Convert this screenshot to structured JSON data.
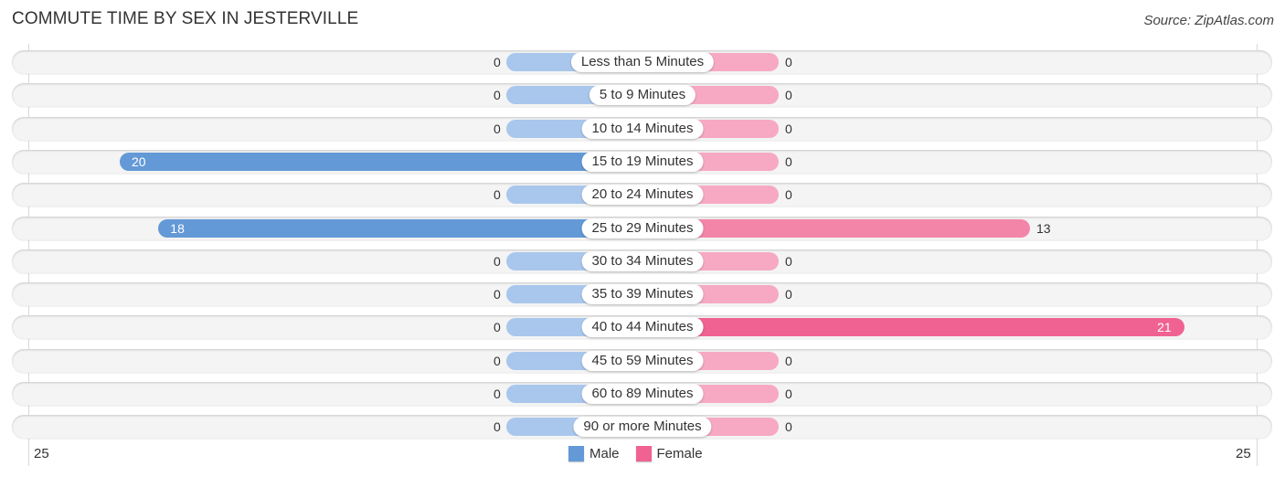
{
  "chart_data": {
    "type": "bar",
    "orientation": "horizontal-diverging",
    "title": "COMMUTE TIME BY SEX IN JESTERVILLE",
    "source": "Source: ZipAtlas.com",
    "categories": [
      "Less than 5 Minutes",
      "5 to 9 Minutes",
      "10 to 14 Minutes",
      "15 to 19 Minutes",
      "20 to 24 Minutes",
      "25 to 29 Minutes",
      "30 to 34 Minutes",
      "35 to 39 Minutes",
      "40 to 44 Minutes",
      "45 to 59 Minutes",
      "60 to 89 Minutes",
      "90 or more Minutes"
    ],
    "series": [
      {
        "name": "Male",
        "values": [
          0,
          0,
          0,
          20,
          0,
          18,
          0,
          0,
          0,
          0,
          0,
          0
        ]
      },
      {
        "name": "Female",
        "values": [
          0,
          0,
          0,
          0,
          0,
          13,
          0,
          0,
          21,
          0,
          0,
          0
        ]
      }
    ],
    "axis": {
      "left_label": "25",
      "right_label": "25",
      "range": [
        -25,
        25
      ]
    },
    "legend": {
      "position": "bottom-center",
      "entries": [
        "Male",
        "Female"
      ]
    },
    "colors": {
      "male": "#6399d6",
      "male_light": "#a9c7ec",
      "female": "#f06292",
      "female_mid": "#f386a8",
      "female_light": "#f7a9c3"
    }
  }
}
